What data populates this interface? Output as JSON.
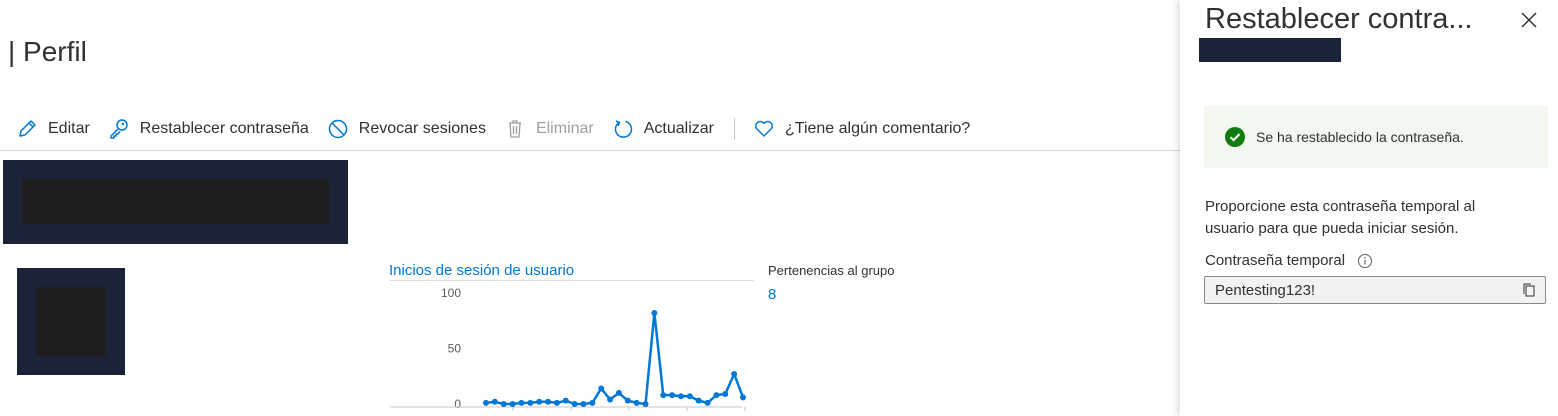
{
  "page": {
    "title": "| Perfil"
  },
  "toolbar": {
    "edit_label": "Editar",
    "reset_password_label": "Restablecer contraseña",
    "revoke_sessions_label": "Revocar sesiones",
    "delete_label": "Eliminar",
    "refresh_label": "Actualizar",
    "feedback_label": "¿Tiene algún comentario?"
  },
  "signins": {
    "title": "Inicios de sesión de usuario"
  },
  "groups": {
    "label": "Pertenencias al grupo",
    "count": "8"
  },
  "chart_data": {
    "type": "line",
    "title": "Inicios de sesión de usuario",
    "ylim": [
      0,
      100
    ],
    "y_ticks": [
      "100",
      "50",
      "0"
    ],
    "grid": false,
    "series": [
      {
        "values": [
          1,
          2,
          0,
          0,
          1,
          1,
          2,
          2,
          1,
          3,
          0,
          0,
          1,
          14,
          4,
          10,
          3,
          1,
          0,
          82,
          8,
          8,
          7,
          7,
          3,
          1,
          8,
          9,
          27,
          6
        ]
      }
    ],
    "line_color": "#0078d4"
  },
  "panel": {
    "title": "Restablecer contra...",
    "success_message": "Se ha restablecido la contraseña.",
    "description": "Proporcione esta contraseña temporal al usuario para que pueda iniciar sesión.",
    "password_label": "Contraseña temporal",
    "password_value": "Pentesting123!"
  },
  "colors": {
    "accent": "#0078d4",
    "success": "#107c10",
    "success_bg": "#f2f8ef",
    "redaction": "#1b2338"
  },
  "icons": {
    "edit": "pencil-icon",
    "reset": "key-icon",
    "revoke": "block-icon",
    "delete": "trash-icon",
    "refresh": "refresh-icon",
    "feedback": "heart-icon",
    "close": "close-icon",
    "success": "checkmark-circle-icon",
    "info": "info-icon",
    "copy": "copy-icon"
  }
}
